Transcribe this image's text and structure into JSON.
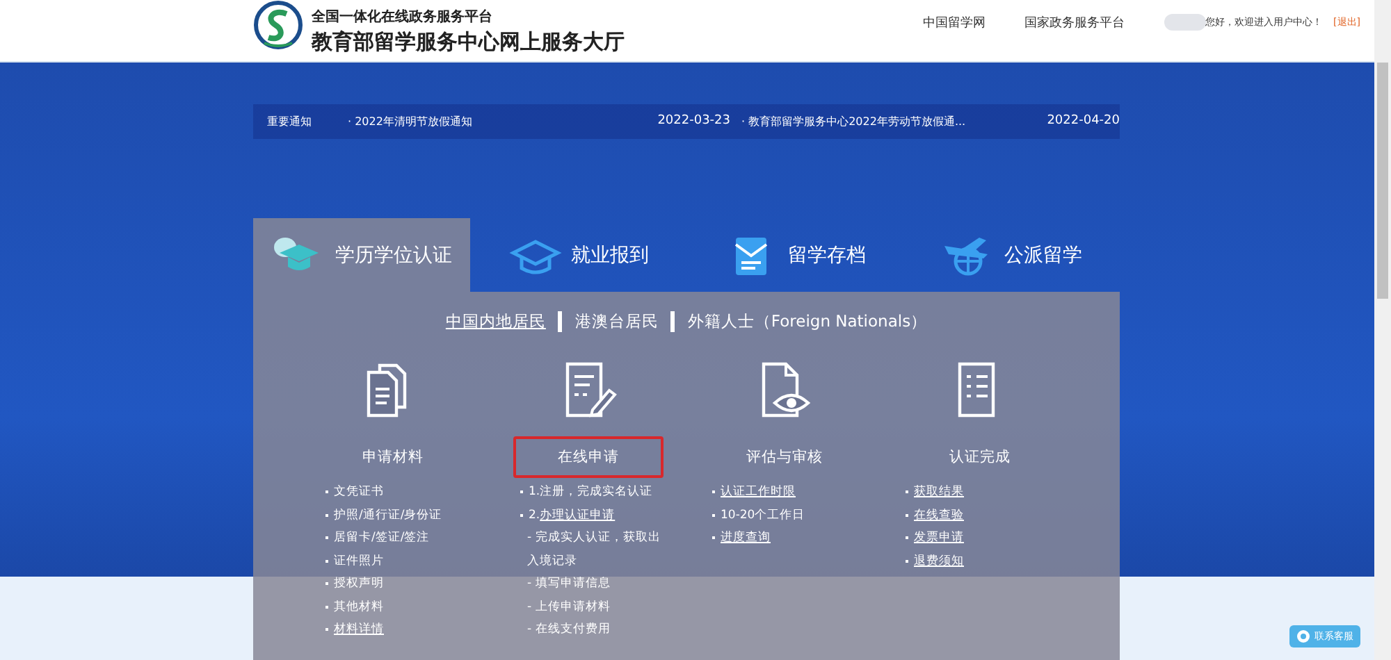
{
  "header": {
    "subtitle": "全国一体化在线政务服务平台",
    "title": "教育部留学服务中心网上服务大厅",
    "links": [
      "中国留学网",
      "国家政务服务平台"
    ],
    "greeting": "您好，欢迎进入用户中心！",
    "logout": "[退出]"
  },
  "notices": {
    "label": "重要通知",
    "items": [
      {
        "text": "· 2022年清明节放假通知",
        "date": "2022-03-23"
      },
      {
        "text": "· 教育部留学服务中心2022年劳动节放假通...",
        "date": "2022-04-20"
      }
    ]
  },
  "tabs": [
    {
      "label": "学历学位认证",
      "selected": true
    },
    {
      "label": "就业报到",
      "selected": false
    },
    {
      "label": "留学存档",
      "selected": false
    },
    {
      "label": "公派留学",
      "selected": false
    }
  ],
  "residents": [
    {
      "label": "中国内地居民",
      "selected": true
    },
    {
      "label": "港澳台居民",
      "selected": false
    },
    {
      "label": "外籍人士（Foreign Nationals）",
      "selected": false
    }
  ],
  "steps": [
    {
      "label": "申请材料",
      "highlighted": false,
      "items": [
        {
          "kind": "bullet",
          "text": "文凭证书",
          "link": false
        },
        {
          "kind": "bullet",
          "text": "护照/通行证/身份证",
          "link": false
        },
        {
          "kind": "bullet",
          "text": "居留卡/签证/签注",
          "link": false
        },
        {
          "kind": "bullet",
          "text": "证件照片",
          "link": false
        },
        {
          "kind": "bullet",
          "text": "授权声明",
          "link": false
        },
        {
          "kind": "bullet",
          "text": "其他材料",
          "link": false
        },
        {
          "kind": "bullet",
          "text": "材料详情",
          "link": true
        }
      ]
    },
    {
      "label": "在线申请",
      "highlighted": true,
      "items": [
        {
          "kind": "bullet",
          "text": "1.注册，完成实名认证",
          "link": false
        },
        {
          "kind": "bullet",
          "prefix": "2.",
          "text": "办理认证申请",
          "link": true
        },
        {
          "kind": "dash",
          "text": "- 完成实人认证，获取出入境记录",
          "link": false
        },
        {
          "kind": "dash",
          "text": "- 填写申请信息",
          "link": false
        },
        {
          "kind": "dash",
          "text": "- 上传申请材料",
          "link": false
        },
        {
          "kind": "dash",
          "text": "- 在线支付费用",
          "link": false
        }
      ]
    },
    {
      "label": "评估与审核",
      "highlighted": false,
      "items": [
        {
          "kind": "bullet",
          "text": "认证工作时限",
          "link": true
        },
        {
          "kind": "bullet",
          "text": "10-20个工作日",
          "link": false
        },
        {
          "kind": "bullet",
          "text": "进度查询",
          "link": true
        }
      ]
    },
    {
      "label": "认证完成",
      "highlighted": false,
      "items": [
        {
          "kind": "bullet",
          "text": "获取结果",
          "link": true
        },
        {
          "kind": "bullet",
          "text": "在线查验",
          "link": true
        },
        {
          "kind": "bullet",
          "text": "发票申请",
          "link": true
        },
        {
          "kind": "bullet",
          "text": "退费须知",
          "link": true
        }
      ]
    }
  ],
  "contact_button": "联系客服"
}
